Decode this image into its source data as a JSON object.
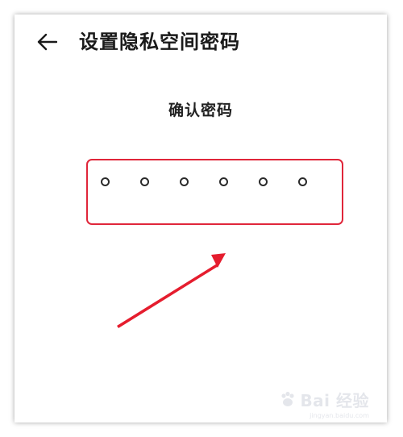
{
  "header": {
    "back_icon": "arrow-left-icon",
    "title": "设置隐私空间密码"
  },
  "main": {
    "prompt": "确认密码",
    "pin": {
      "length": 6,
      "filled": 0
    }
  },
  "annotation": {
    "arrow_color": "#e51d2e",
    "box_color": "#e0263a"
  },
  "watermark": {
    "logo_text": "Bai 经验",
    "site": "jingyan.baidu.com"
  }
}
